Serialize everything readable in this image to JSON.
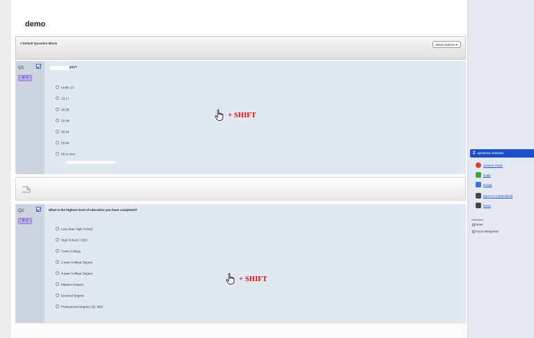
{
  "survey": {
    "title": "demo"
  },
  "block": {
    "title": "Default Question Block",
    "options_label": "Block Options"
  },
  "questions": [
    {
      "number": "Q1",
      "text": "you?",
      "choices": [
        "Under 13",
        "13-17",
        "18-25",
        "26-34",
        "35-54",
        "55-64",
        "65 or over"
      ]
    },
    {
      "number": "Q2",
      "text": "What is the highest level of education you have completed?",
      "choices": [
        "Less than High School",
        "High School / GED",
        "Some College",
        "2-year College Degree",
        "4-year College Degree",
        "Masters Degree",
        "Doctoral Degree",
        "Professional Degree (JD, MD)"
      ]
    }
  ],
  "annotation": {
    "shift_label": "+ SHIFT"
  },
  "selection_panel": {
    "count": "2",
    "header": "questions selected",
    "actions": [
      {
        "label": "Send to Trash",
        "icon": "trash-icon",
        "color": "#d9432a"
      },
      {
        "label": "Copy",
        "icon": "copy-icon",
        "color": "#3fa33a"
      },
      {
        "label": "Group",
        "icon": "group-icon",
        "color": "#3a6fd8"
      },
      {
        "label": "Move to a New Block",
        "icon": "move-block-icon",
        "color": "#444444"
      },
      {
        "label": "Move",
        "icon": "move-icon",
        "color": "#444444"
      }
    ],
    "validation_label": "Validation",
    "validation_options": [
      "None",
      "Force Response"
    ]
  },
  "colors": {
    "accent": "#1f4fc8",
    "question_bg": "#e2e8f2",
    "shift_red": "#cc0000"
  }
}
